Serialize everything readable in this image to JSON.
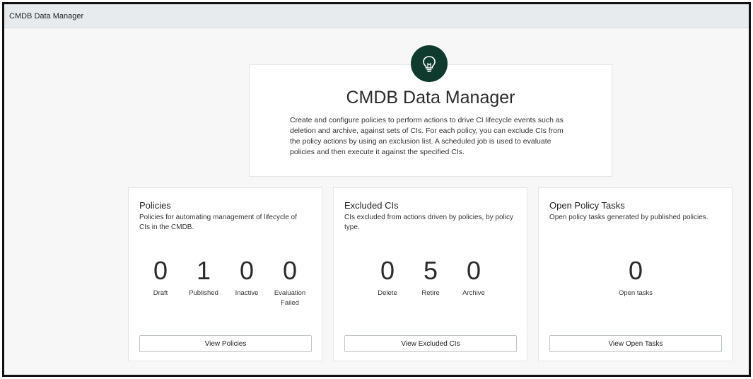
{
  "titlebar": {
    "title": "CMDB Data Manager"
  },
  "hero": {
    "icon": "lightbulb-icon",
    "title": "CMDB Data Manager",
    "description": "Create and configure policies to perform actions to drive CI lifecycle events such as deletion and archive, against sets of CIs. For each policy, you can exclude CIs from the policy actions by using an exclusion list. A scheduled job is used to evaluate policies and then execute it against the specified CIs."
  },
  "cards": [
    {
      "title": "Policies",
      "description": "Policies for automating management of lifecycle of CIs in the CMDB.",
      "stats": [
        {
          "value": "0",
          "label": "Draft"
        },
        {
          "value": "1",
          "label": "Published"
        },
        {
          "value": "0",
          "label": "Inactive"
        },
        {
          "value": "0",
          "label": "Evaluation Failed"
        }
      ],
      "button": "View Policies"
    },
    {
      "title": "Excluded CIs",
      "description": "CIs excluded from actions driven by policies, by policy type.",
      "stats": [
        {
          "value": "0",
          "label": "Delete"
        },
        {
          "value": "5",
          "label": "Retire"
        },
        {
          "value": "0",
          "label": "Archive"
        }
      ],
      "button": "View Excluded CIs"
    },
    {
      "title": "Open Policy Tasks",
      "description": "Open policy tasks generated by published policies.",
      "stats": [
        {
          "value": "0",
          "label": "Open tasks"
        }
      ],
      "button": "View Open Tasks"
    }
  ],
  "colors": {
    "icon_circle": "#0f3b2e",
    "background": "#f7f7f8"
  }
}
